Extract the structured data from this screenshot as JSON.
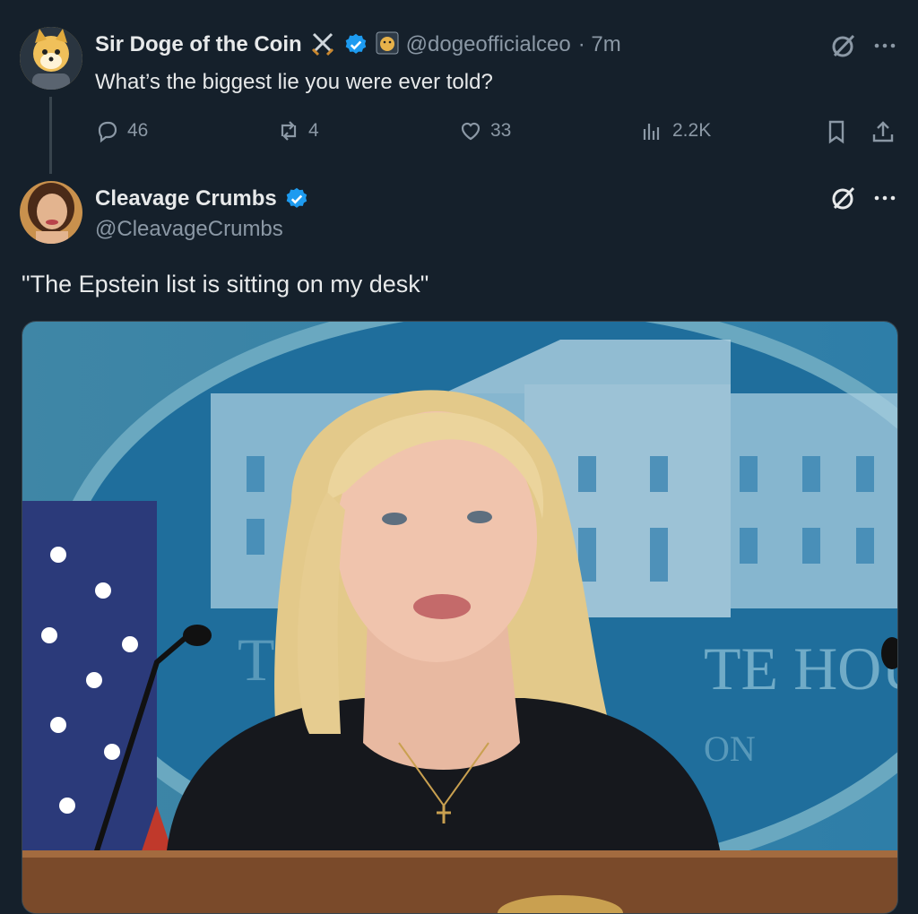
{
  "tweet1": {
    "name": "Sir Doge of the Coin",
    "handle": "@dogeofficialceo",
    "time": "· 7m",
    "text": "What’s the biggest lie you were ever told?",
    "stats": {
      "replies": "46",
      "reposts": "4",
      "likes": "33",
      "views": "2.2K"
    },
    "emoji_icons": [
      "crossed-swords-icon",
      "verified-badge-icon",
      "doge-badge-icon"
    ]
  },
  "tweet2": {
    "name": "Cleavage Crumbs",
    "handle": "@CleavageCrumbs",
    "text": "\"The Epstein list is sitting on my desk\"",
    "media": {
      "sign_text_main": "TE HOUS",
      "sign_text_left": "T",
      "sign_text_sub": "ON"
    }
  },
  "colors": {
    "background": "#15202b",
    "muted": "#8b98a5",
    "verified": "#1d9bf0",
    "divider": "#38444d"
  }
}
